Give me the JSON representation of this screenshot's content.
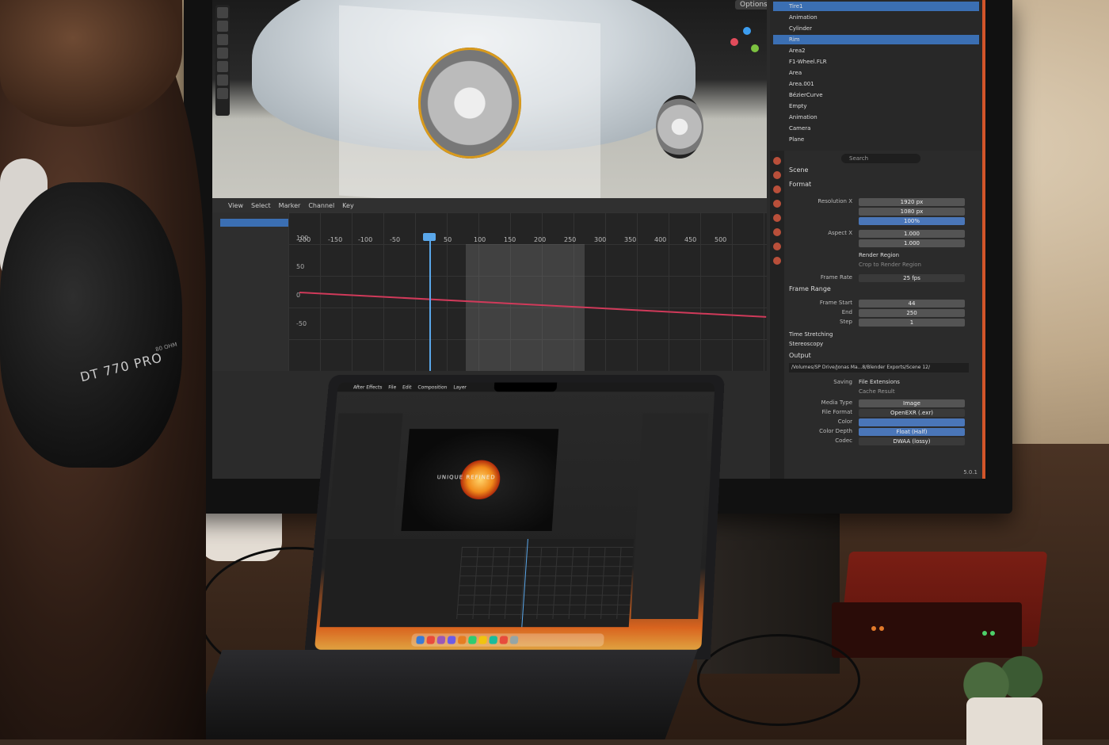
{
  "scene": {
    "headphones": {
      "label": "DT 770 PRO",
      "sublabel": "80 OHM"
    },
    "monitor": {
      "app": "Blender",
      "viewport": {
        "options_label": "Options"
      },
      "graph_editor": {
        "menu": [
          "View",
          "Select",
          "Marker",
          "Channel",
          "Key"
        ],
        "ruler": [
          "-200",
          "-150",
          "-100",
          "-50",
          "50",
          "100",
          "150",
          "200",
          "250",
          "300",
          "350",
          "400",
          "450",
          "500"
        ],
        "y_labels": [
          "100",
          "50",
          "0",
          "-50"
        ]
      },
      "outliner": {
        "rows": [
          "Tire1",
          "Animation",
          "Cylinder",
          "Rim",
          "Area2",
          "F1-Wheel.FLR",
          "Area",
          "Area.001",
          "BézierCurve",
          "Empty",
          "Animation",
          "Camera",
          "Plane"
        ],
        "selected_rows": [
          0,
          3
        ]
      },
      "properties": {
        "search_placeholder": "Search",
        "scene_label": "Scene",
        "format_section": "Format",
        "resolution_x_label": "Resolution X",
        "resolution_x": "1920 px",
        "resolution_y": "1080 px",
        "resolution_pct": "100%",
        "aspect_x_label": "Aspect X",
        "aspect_x": "1.000",
        "aspect_y": "1.000",
        "render_region": "Render Region",
        "crop_region": "Crop to Render Region",
        "frame_rate_label": "Frame Rate",
        "frame_rate": "25 fps",
        "frame_range_section": "Frame Range",
        "frame_start_label": "Frame Start",
        "frame_start": "44",
        "end_label": "End",
        "end_value": "250",
        "step_label": "Step",
        "step_value": "1",
        "time_stretching": "Time Stretching",
        "stereoscopy": "Stereoscopy",
        "output_section": "Output",
        "output_path": "/Volumes/SP Drive/Jonas Ma...8/Blender Exports/Scene 12/",
        "saving_label": "Saving",
        "file_extensions": "File Extensions",
        "cache_result": "Cache Result",
        "media_type_label": "Media Type",
        "media_type": "Image",
        "file_format_label": "File Format",
        "file_format": "OpenEXR (.exr)",
        "color_label": "Color",
        "color_depth_label": "Color Depth",
        "color_depth": "Float (Half)",
        "codec_label": "Codec",
        "codec": "DWAA (lossy)",
        "version": "5.0.1"
      }
    },
    "laptop": {
      "app": "After Effects",
      "menubar": [
        "After Effects",
        "File",
        "Edit",
        "Composition",
        "Layer"
      ],
      "comp_text": "UNIQUE REFINED"
    },
    "colors": {
      "blender_accent": "#3b6fb3",
      "playhead": "#5aa7ea",
      "fcurve": "#d03a5a",
      "monitor_glow": "#d2552a",
      "ae_logo": "#f08a1a"
    }
  }
}
